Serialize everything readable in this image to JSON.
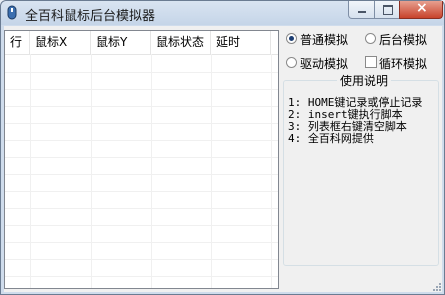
{
  "window": {
    "title": "全百科鼠标后台模拟器",
    "controls": {
      "minimize": "",
      "maximize": "",
      "close": "×"
    }
  },
  "table": {
    "columns": [
      "行",
      "鼠标X",
      "鼠标Y",
      "鼠标状态",
      "延时"
    ],
    "rows": []
  },
  "mode": {
    "options": [
      {
        "label": "普通模拟",
        "checked": true
      },
      {
        "label": "后台模拟",
        "checked": false
      },
      {
        "label": "驱动模拟",
        "checked": false
      }
    ],
    "loop_label": "循环模拟",
    "loop_checked": false
  },
  "help": {
    "title": "使用说明",
    "lines": [
      "1: HOME键记录或停止记录",
      "2: insert键执行脚本",
      "3: 列表框右键清空脚本",
      "4: 全百科网提供"
    ]
  },
  "colors": {
    "accent": "#1c3e73",
    "close_button": "#c8432b"
  }
}
